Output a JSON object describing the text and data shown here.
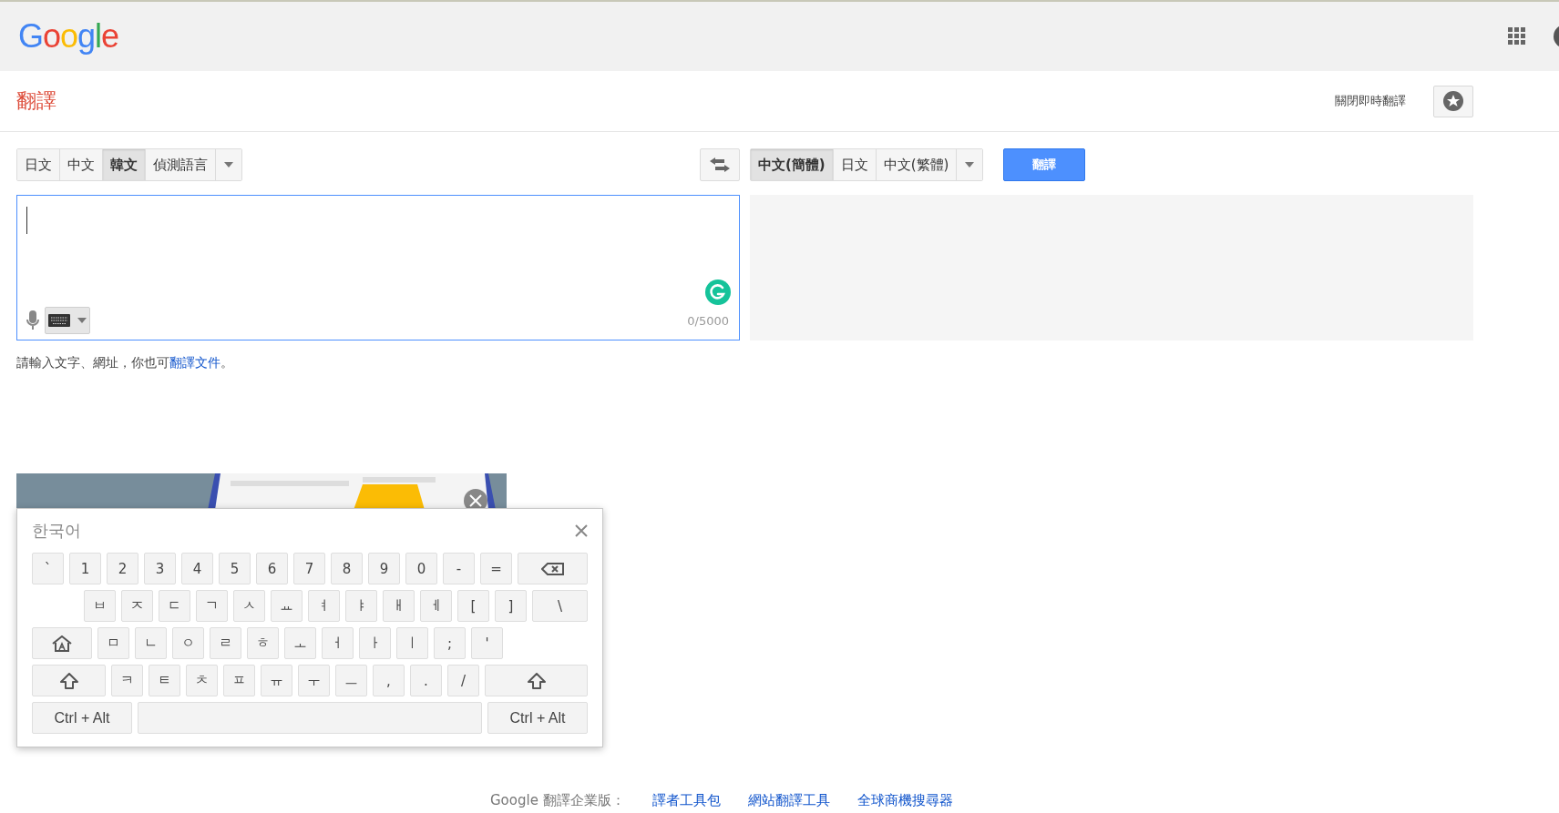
{
  "header": {
    "logo": "Google"
  },
  "app_title": "翻譯",
  "instant_toggle": "關閉即時翻譯",
  "source_languages": [
    {
      "label": "日文",
      "selected": false
    },
    {
      "label": "中文",
      "selected": false
    },
    {
      "label": "韓文",
      "selected": true
    },
    {
      "label": "偵測語言",
      "selected": false
    }
  ],
  "target_languages": [
    {
      "label": "中文(簡體)",
      "selected": true
    },
    {
      "label": "日文",
      "selected": false
    },
    {
      "label": "中文(繁體)",
      "selected": false
    }
  ],
  "translate_button": "翻譯",
  "source": {
    "char_count": "0/5000"
  },
  "hint": {
    "text": "請輸入文字、網址，你也可",
    "link": "翻譯文件",
    "end": "。"
  },
  "keyboard": {
    "title": "한국어",
    "rows": [
      [
        {
          "kind": "char",
          "label": "`"
        },
        {
          "kind": "char",
          "label": "1"
        },
        {
          "kind": "char",
          "label": "2"
        },
        {
          "kind": "char",
          "label": "3"
        },
        {
          "kind": "char",
          "label": "4"
        },
        {
          "kind": "char",
          "label": "5"
        },
        {
          "kind": "char",
          "label": "6"
        },
        {
          "kind": "char",
          "label": "7"
        },
        {
          "kind": "char",
          "label": "8"
        },
        {
          "kind": "char",
          "label": "9"
        },
        {
          "kind": "char",
          "label": "0"
        },
        {
          "kind": "char",
          "label": "-"
        },
        {
          "kind": "char",
          "label": "="
        },
        {
          "kind": "backspace"
        }
      ],
      [
        {
          "kind": "char",
          "label": "ㅂ"
        },
        {
          "kind": "char",
          "label": "ㅈ"
        },
        {
          "kind": "char",
          "label": "ㄷ"
        },
        {
          "kind": "char",
          "label": "ㄱ"
        },
        {
          "kind": "char",
          "label": "ㅅ"
        },
        {
          "kind": "char",
          "label": "ㅛ"
        },
        {
          "kind": "char",
          "label": "ㅕ"
        },
        {
          "kind": "char",
          "label": "ㅑ"
        },
        {
          "kind": "char",
          "label": "ㅐ"
        },
        {
          "kind": "char",
          "label": "ㅔ"
        },
        {
          "kind": "char",
          "label": "["
        },
        {
          "kind": "char",
          "label": "]"
        },
        {
          "kind": "wide",
          "label": "\\"
        }
      ],
      [
        {
          "kind": "caps"
        },
        {
          "kind": "char",
          "label": "ㅁ"
        },
        {
          "kind": "char",
          "label": "ㄴ"
        },
        {
          "kind": "char",
          "label": "ㅇ"
        },
        {
          "kind": "char",
          "label": "ㄹ"
        },
        {
          "kind": "char",
          "label": "ㅎ"
        },
        {
          "kind": "char",
          "label": "ㅗ"
        },
        {
          "kind": "char",
          "label": "ㅓ"
        },
        {
          "kind": "char",
          "label": "ㅏ"
        },
        {
          "kind": "char",
          "label": "ㅣ"
        },
        {
          "kind": "char",
          "label": ";"
        },
        {
          "kind": "char",
          "label": "'"
        }
      ],
      [
        {
          "kind": "shift"
        },
        {
          "kind": "char",
          "label": "ㅋ"
        },
        {
          "kind": "char",
          "label": "ㅌ"
        },
        {
          "kind": "char",
          "label": "ㅊ"
        },
        {
          "kind": "char",
          "label": "ㅍ"
        },
        {
          "kind": "char",
          "label": "ㅠ"
        },
        {
          "kind": "char",
          "label": "ㅜ"
        },
        {
          "kind": "char",
          "label": "ㅡ"
        },
        {
          "kind": "char",
          "label": ","
        },
        {
          "kind": "char",
          "label": "."
        },
        {
          "kind": "char",
          "label": "/"
        },
        {
          "kind": "shift"
        }
      ],
      [
        {
          "kind": "ctrl",
          "label": "Ctrl + Alt"
        },
        {
          "kind": "space"
        },
        {
          "kind": "ctrl",
          "label": "Ctrl + Alt"
        }
      ]
    ]
  },
  "footer": {
    "label": "Google 翻譯企業版：",
    "links": [
      "譯者工具包",
      "網站翻譯工具",
      "全球商機搜尋器"
    ]
  }
}
